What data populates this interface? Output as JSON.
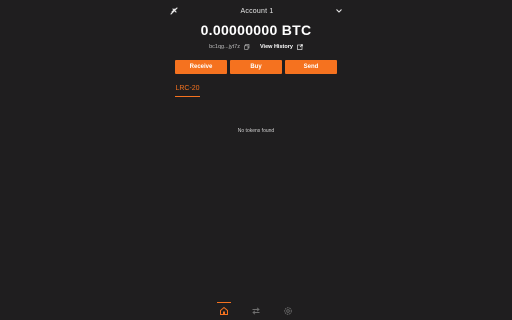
{
  "header": {
    "account_label": "Account 1"
  },
  "wallet": {
    "balance": "0.00000000 BTC",
    "address": "bc1qg...jyt7z",
    "view_history_label": "View History"
  },
  "actions": {
    "receive": "Receive",
    "buy": "Buy",
    "send": "Send"
  },
  "tabs": [
    {
      "label": "LRC-20",
      "active": true
    }
  ],
  "tokens": {
    "empty_message": "No tokens found"
  },
  "nav": [
    "home-icon",
    "swap-arrows-icon",
    "settings-gear-icon"
  ],
  "colors": {
    "accent": "#f5721f",
    "background": "#1f1e1f"
  }
}
